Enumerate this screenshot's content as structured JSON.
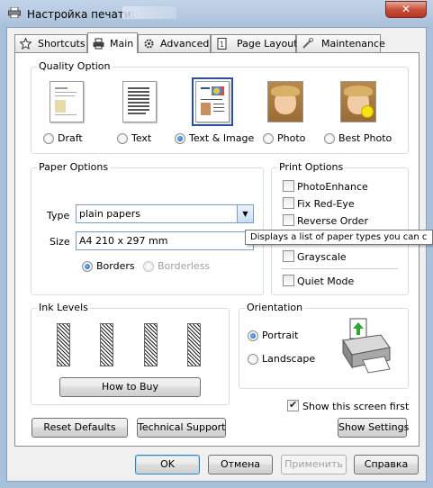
{
  "window": {
    "title": "Настройка печати:"
  },
  "tabs": [
    {
      "label": "Shortcuts",
      "icon": "star-icon"
    },
    {
      "label": "Main",
      "icon": "printer-icon"
    },
    {
      "label": "Advanced",
      "icon": "gear-icon"
    },
    {
      "label": "Page Layout",
      "icon": "page-icon"
    },
    {
      "label": "Maintenance",
      "icon": "wrench-icon"
    }
  ],
  "quality": {
    "title": "Quality Option",
    "options": [
      {
        "label": "Draft",
        "selected": false
      },
      {
        "label": "Text",
        "selected": false
      },
      {
        "label": "Text & Image",
        "selected": true
      },
      {
        "label": "Photo",
        "selected": false
      },
      {
        "label": "Best Photo",
        "selected": false
      }
    ]
  },
  "paper": {
    "title": "Paper Options",
    "type_label": "Type",
    "type_value": "plain papers",
    "size_label": "Size",
    "size_value": "A4 210 x 297 mm",
    "borders_label": "Borders",
    "borderless_label": "Borderless"
  },
  "tooltip": "Displays a list of paper types you can c",
  "print_options": {
    "title": "Print Options",
    "items": [
      {
        "label": "PhotoEnhance",
        "checked": false
      },
      {
        "label": "Fix Red-Eye",
        "checked": false
      },
      {
        "label": "Reverse Order",
        "checked": false
      },
      {
        "label": "Grayscale",
        "checked": false
      },
      {
        "label": "Quiet Mode",
        "checked": false
      }
    ]
  },
  "ink": {
    "title": "Ink Levels",
    "how_to_buy": "How to Buy"
  },
  "orientation": {
    "title": "Orientation",
    "portrait": "Portrait",
    "landscape": "Landscape"
  },
  "show_first": {
    "label": "Show this screen first",
    "checked": true
  },
  "buttons": {
    "reset": "Reset Defaults",
    "support": "Technical Support",
    "show_settings": "Show Settings",
    "ok": "OK",
    "cancel": "Отмена",
    "apply": "Применить",
    "help": "Справка"
  },
  "colors": {
    "accent": "#2b4f9a",
    "title_bar": "#a9c0da",
    "close": "#c7503a"
  }
}
